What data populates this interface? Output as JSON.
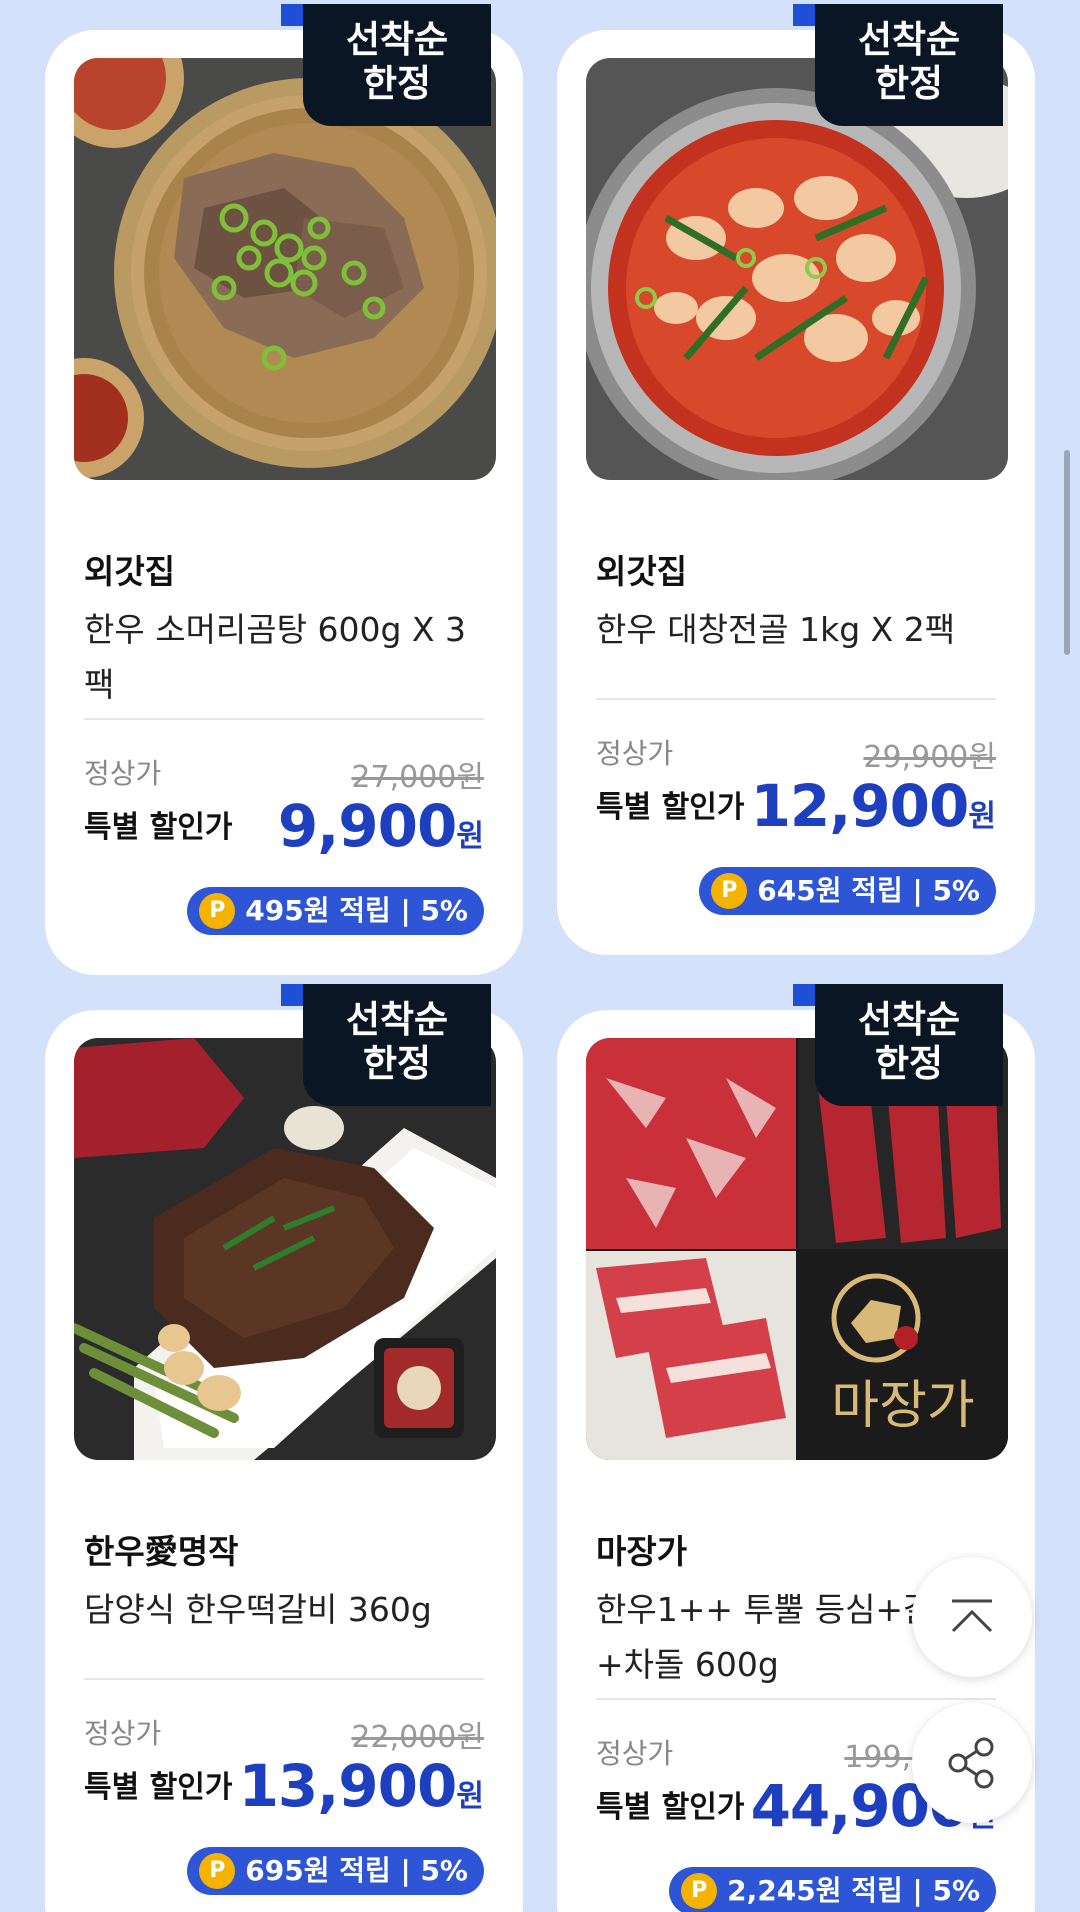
{
  "products": [
    {
      "badge_line1": "선착순",
      "badge_line2": "한정",
      "brand": "외갓집",
      "name": "한우 소머리곰탕 600g X 3팩",
      "regular_label": "정상가",
      "regular_price": "27,000원",
      "sale_label": "특별 할인가",
      "sale_price": "9,900",
      "sale_unit": "원",
      "points_text": "495원 적립 | 5%",
      "image_icon": "beef-soup-image"
    },
    {
      "badge_line1": "선착순",
      "badge_line2": "한정",
      "brand": "외갓집",
      "name": "한우 대창전골 1kg X 2팩",
      "regular_label": "정상가",
      "regular_price": "29,900원",
      "sale_label": "특별 할인가",
      "sale_price": "12,900",
      "sale_unit": "원",
      "points_text": "645원 적립 | 5%",
      "image_icon": "intestine-hotpot-image"
    },
    {
      "badge_line1": "선착순",
      "badge_line2": "한정",
      "brand": "한우愛명작",
      "name": "담양식 한우떡갈비 360g",
      "regular_label": "정상가",
      "regular_price": "22,000원",
      "sale_label": "특별 할인가",
      "sale_price": "13,900",
      "sale_unit": "원",
      "points_text": "695원 적립 | 5%",
      "image_icon": "grilled-patty-image"
    },
    {
      "badge_line1": "선착순",
      "badge_line2": "한정",
      "brand": "마장가",
      "name": "한우1++ 투뿔 등심+갈비살+차돌 600g",
      "regular_label": "정상가",
      "regular_price": "199,000원",
      "sale_label": "특별 할인가",
      "sale_price": "44,900",
      "sale_unit": "원",
      "points_text": "2,245원 적립 | 5%",
      "image_icon": "raw-beef-collage-image",
      "logo_text": "마장가"
    }
  ],
  "points_icon_label": "P",
  "fabs": {
    "scroll_top_icon": "chevron-up-icon",
    "share_icon": "share-icon"
  },
  "colors": {
    "background": "#d4e1fb",
    "badge": "#0b1624",
    "sale_price": "#1e3fbf",
    "points_pill": "#2d55d6",
    "points_icon": "#f5b300"
  }
}
